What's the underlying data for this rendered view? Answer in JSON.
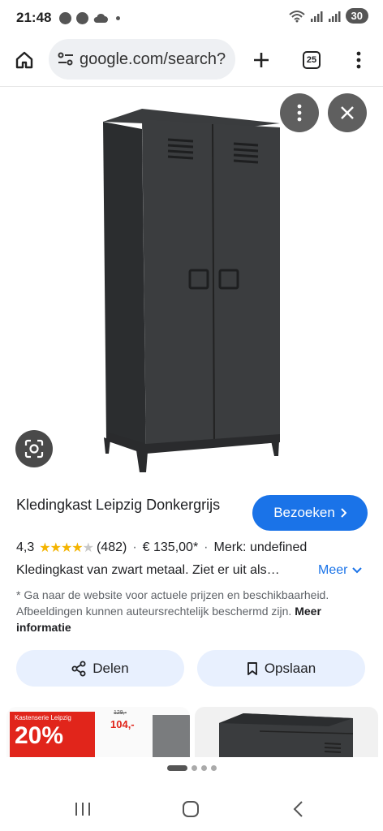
{
  "status_bar": {
    "time": "21:48",
    "battery": "30"
  },
  "browser": {
    "url": "google.com/search?",
    "tab_count": "25"
  },
  "product": {
    "title": "Kledingkast Leipzig Donkergrijs",
    "visit_label": "Bezoeken",
    "rating": "4,3",
    "stars_filled": 4,
    "review_count": "(482)",
    "price": "€ 135,00*",
    "brand": "Merk: undefined",
    "description": "Kledingkast van zwart metaal. Ziet er uit als…",
    "more_label": "Meer",
    "disclaimer": "* Ga naar de website voor actuele prijzen en beschikbaarheid. Afbeeldingen kunnen auteursrechtelijk beschermd zijn.",
    "more_info_label": "Meer informatie"
  },
  "actions": {
    "share_label": "Delen",
    "save_label": "Opslaan"
  },
  "related": {
    "promo_small": "Kastenserie Leipzig",
    "promo_big": "20%",
    "promo_price": "104,-",
    "promo_strike": "129,-"
  },
  "colors": {
    "accent": "#1a73e8",
    "action_bg": "#e8f0fe",
    "star": "#f4b400",
    "promo_red": "#e1251b"
  }
}
